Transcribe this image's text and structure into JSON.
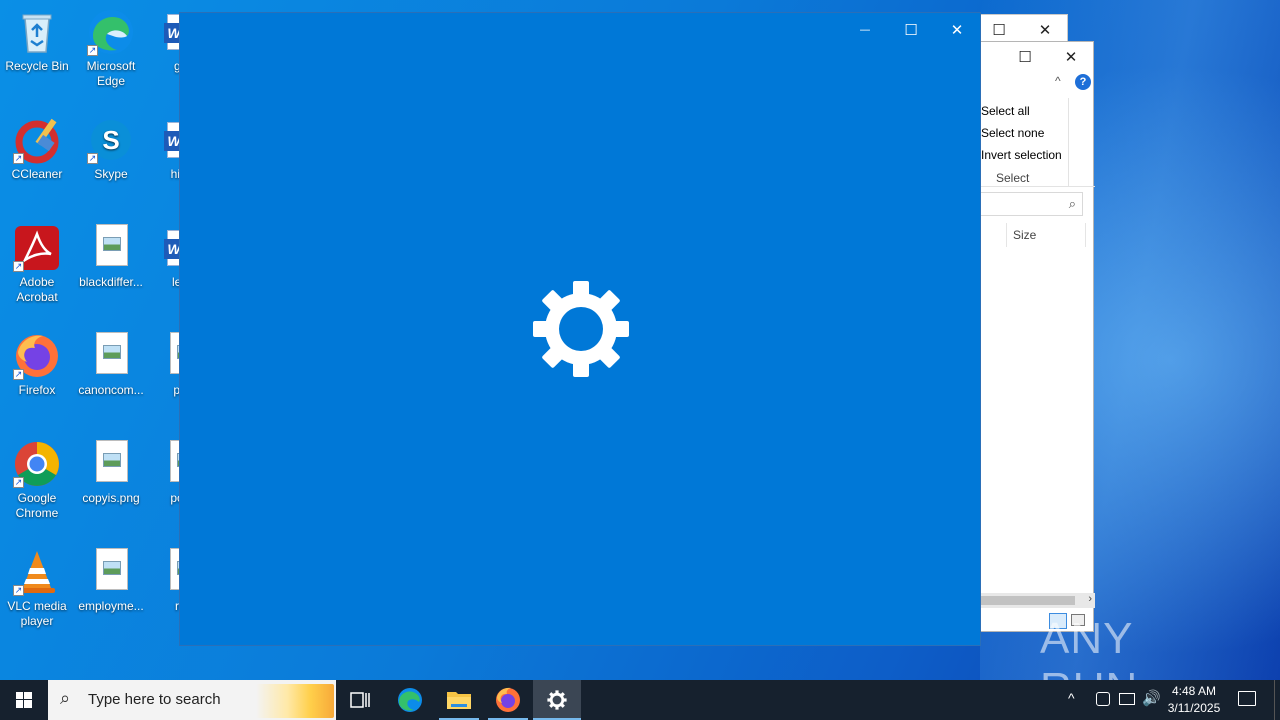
{
  "desktop": {
    "icons": [
      {
        "label": "Recycle Bin",
        "icon": "recycle-bin-icon"
      },
      {
        "label": "Microsoft Edge",
        "icon": "edge-icon"
      },
      {
        "label": "gifts",
        "icon": "word-doc-icon"
      },
      {
        "label": "CCleaner",
        "icon": "ccleaner-icon"
      },
      {
        "label": "Skype",
        "icon": "skype-icon"
      },
      {
        "label": "hitsfo",
        "icon": "word-doc-icon"
      },
      {
        "label": "Adobe Acrobat",
        "icon": "acrobat-icon"
      },
      {
        "label": "blackdiffer...",
        "icon": "image-file-icon"
      },
      {
        "label": "leath",
        "icon": "word-doc-icon"
      },
      {
        "label": "Firefox",
        "icon": "firefox-icon"
      },
      {
        "label": "canoncom...",
        "icon": "image-file-icon"
      },
      {
        "label": "parti",
        "icon": "image-file-icon"
      },
      {
        "label": "Google Chrome",
        "icon": "chrome-icon"
      },
      {
        "label": "copyis.png",
        "icon": "image-file-icon"
      },
      {
        "label": "poste",
        "icon": "image-file-icon"
      },
      {
        "label": "VLC media player",
        "icon": "vlc-icon"
      },
      {
        "label": "employme...",
        "icon": "image-file-icon"
      },
      {
        "label": "regi",
        "icon": "image-file-icon"
      }
    ]
  },
  "explorer_back": {
    "ribbon": {
      "select_all": "Select all",
      "select_none": "Select none",
      "invert_selection": "Invert selection",
      "group_label": "Select"
    },
    "column_size": "Size",
    "help_glyph": "?"
  },
  "settings_window": {
    "minimize_glyph": "—",
    "maximize_glyph": "☐",
    "close_glyph": "✕",
    "splash_icon": "gear-icon",
    "background": "#0078d7"
  },
  "taskbar": {
    "search_placeholder": "Type here to search",
    "time": "4:48 AM",
    "date": "3/11/2025",
    "pinned": [
      "task-view-icon",
      "edge-icon",
      "file-explorer-icon",
      "firefox-icon",
      "settings-icon"
    ]
  },
  "watermark": {
    "text": "ANY RUN"
  }
}
